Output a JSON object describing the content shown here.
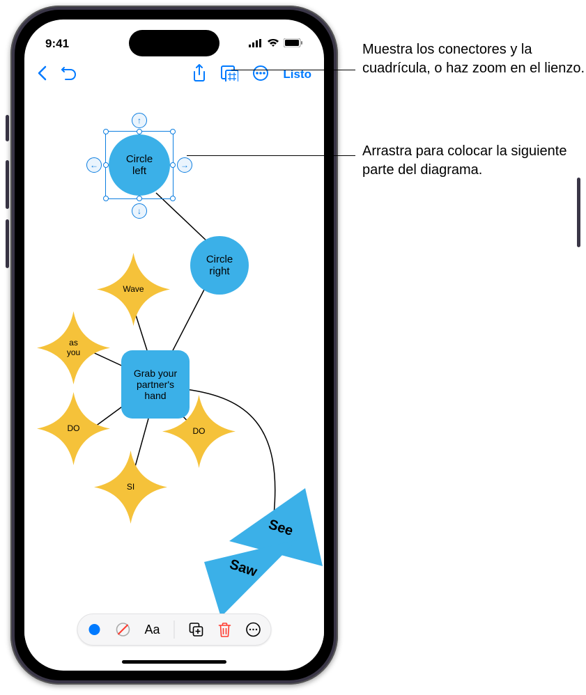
{
  "status": {
    "time": "9:41"
  },
  "toolbar": {
    "done": "Listo"
  },
  "shapes": {
    "circle_left": "Circle\nleft",
    "circle_right": "Circle\nright",
    "grab": "Grab your\npartner's\nhand",
    "wave": "Wave",
    "as_you": "as\nyou",
    "do1": "DO",
    "si": "SI",
    "do2": "DO",
    "see": "See",
    "saw": "Saw"
  },
  "bottom_toolbar": {
    "style_label": "Aa"
  },
  "callouts": {
    "grid": "Muestra los conectores y la cuadrícula, o haz zoom en el lienzo.",
    "drag": "Arrastra para colocar la siguiente parte del diagrama."
  }
}
